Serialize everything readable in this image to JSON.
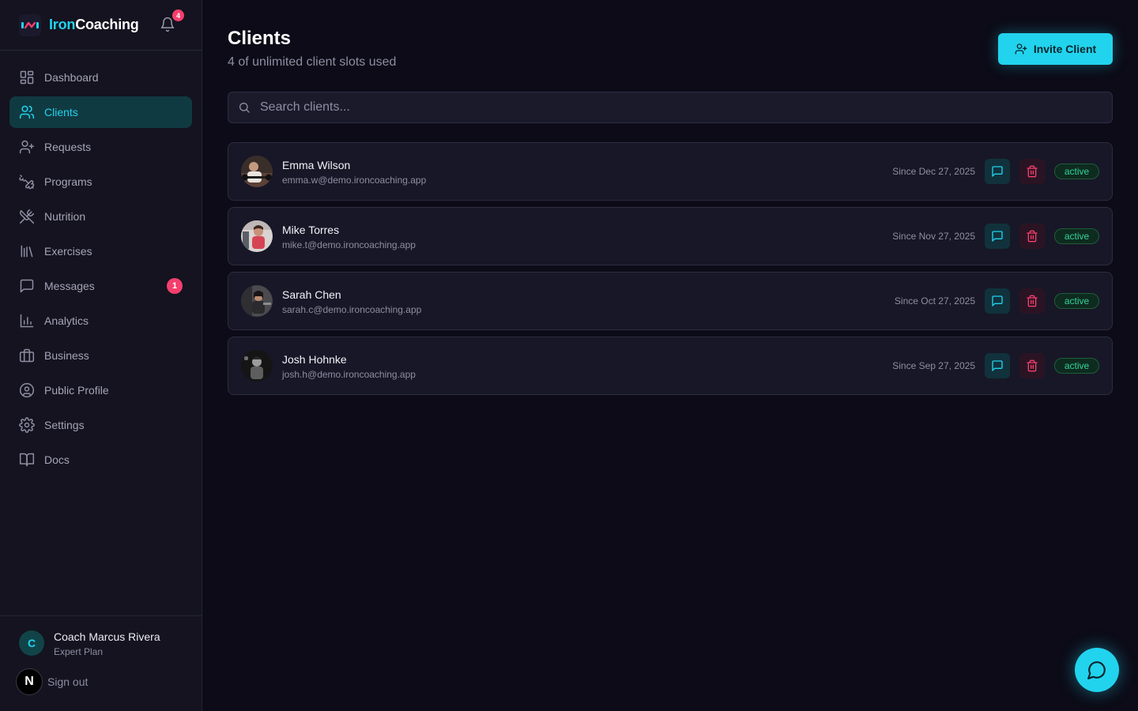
{
  "brand": {
    "name_part1": "Iron",
    "name_part2": "Coaching",
    "accent_color": "#22d3ee",
    "icon": "ironcoaching-logo"
  },
  "notifications": {
    "icon": "bell-icon",
    "count": "4"
  },
  "sidebar": {
    "items": [
      {
        "label": "Dashboard",
        "icon": "dashboard-icon"
      },
      {
        "label": "Clients",
        "icon": "users-icon",
        "active": true
      },
      {
        "label": "Requests",
        "icon": "user-plus-icon"
      },
      {
        "label": "Programs",
        "icon": "dumbbell-icon"
      },
      {
        "label": "Nutrition",
        "icon": "utensils-icon"
      },
      {
        "label": "Exercises",
        "icon": "library-icon"
      },
      {
        "label": "Messages",
        "icon": "message-icon",
        "badge": "1"
      },
      {
        "label": "Analytics",
        "icon": "bar-chart-icon"
      },
      {
        "label": "Business",
        "icon": "briefcase-icon"
      },
      {
        "label": "Public Profile",
        "icon": "user-circle-icon"
      },
      {
        "label": "Settings",
        "icon": "gear-icon"
      },
      {
        "label": "Docs",
        "icon": "book-icon"
      }
    ]
  },
  "user": {
    "initial": "C",
    "name": "Coach Marcus Rivera",
    "plan": "Expert Plan",
    "signout_icon_letter": "N",
    "signout_label": "Sign out"
  },
  "header": {
    "title": "Clients",
    "subtitle": "4 of unlimited client slots used",
    "invite_label": "Invite Client"
  },
  "search": {
    "placeholder": "Search clients..."
  },
  "clients": [
    {
      "name": "Emma Wilson",
      "email": "emma.w@demo.ironcoaching.app",
      "since": "Since Dec 27, 2025",
      "status": "active"
    },
    {
      "name": "Mike Torres",
      "email": "mike.t@demo.ironcoaching.app",
      "since": "Since Nov 27, 2025",
      "status": "active"
    },
    {
      "name": "Sarah Chen",
      "email": "sarah.c@demo.ironcoaching.app",
      "since": "Since Oct 27, 2025",
      "status": "active"
    },
    {
      "name": "Josh Hohnke",
      "email": "josh.h@demo.ironcoaching.app",
      "since": "Since Sep 27, 2025",
      "status": "active"
    }
  ],
  "colors": {
    "background": "#0c0b17",
    "sidebar": "#14131f",
    "accent": "#22d3ee",
    "danger": "#f43f6e",
    "success": "#34d399"
  }
}
